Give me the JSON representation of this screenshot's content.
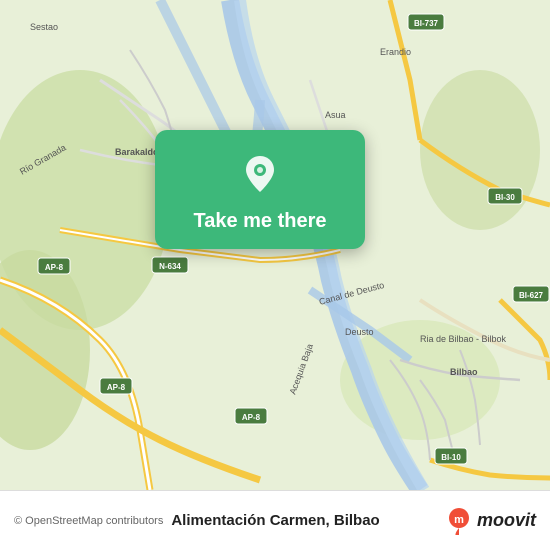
{
  "map": {
    "attribution": "© OpenStreetMap contributors",
    "background_color": "#e8f0d8"
  },
  "card": {
    "button_label": "Take me there",
    "icon": "location-pin-icon"
  },
  "bottom_bar": {
    "place_name": "Alimentación Carmen, Bilbao",
    "logo_text": "moovit"
  },
  "road_labels": [
    {
      "id": "sestao",
      "label": "Sestao"
    },
    {
      "id": "barakaldo",
      "label": "Barakaldo"
    },
    {
      "id": "erandio",
      "label": "Erandio"
    },
    {
      "id": "bilbao",
      "label": "Bilbao"
    },
    {
      "id": "n634",
      "label": "N-634"
    },
    {
      "id": "ap8",
      "label": "AP-8"
    },
    {
      "id": "bi737",
      "label": "BI-737"
    },
    {
      "id": "bi30",
      "label": "BI-30"
    },
    {
      "id": "bi627",
      "label": "BI-627"
    },
    {
      "id": "bi10",
      "label": "BI-10"
    }
  ]
}
